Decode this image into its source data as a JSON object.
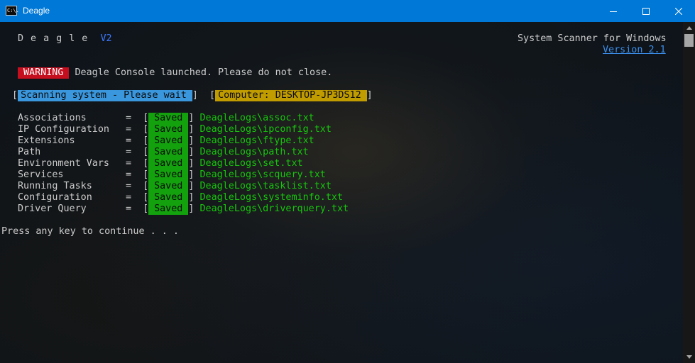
{
  "window": {
    "title": "Deagle",
    "icon": "console-icon",
    "icon_text": "C:\\.",
    "controls": [
      "minimize-icon",
      "maximize-icon",
      "close-icon"
    ]
  },
  "header": {
    "brand": "Deagle",
    "brand_version": "V2",
    "subtitle": "System Scanner for Windows",
    "version_link": "Version 2.1"
  },
  "warning": {
    "badge": "WARNING",
    "message": "Deagle Console launched. Please do not close."
  },
  "status": {
    "scanning": "Scanning system - Please wait",
    "computer": "Computer: DESKTOP-JP3DS12"
  },
  "results": [
    {
      "label": "Associations",
      "status": "Saved",
      "path": "DeagleLogs\\assoc.txt"
    },
    {
      "label": "IP Configuration",
      "status": "Saved",
      "path": "DeagleLogs\\ipconfig.txt"
    },
    {
      "label": "Extensions",
      "status": "Saved",
      "path": "DeagleLogs\\ftype.txt"
    },
    {
      "label": "Path",
      "status": "Saved",
      "path": "DeagleLogs\\path.txt"
    },
    {
      "label": "Environment Vars",
      "status": "Saved",
      "path": "DeagleLogs\\set.txt"
    },
    {
      "label": "Services",
      "status": "Saved",
      "path": "DeagleLogs\\scquery.txt"
    },
    {
      "label": "Running Tasks",
      "status": "Saved",
      "path": "DeagleLogs\\tasklist.txt"
    },
    {
      "label": "Configuration",
      "status": "Saved",
      "path": "DeagleLogs\\systeminfo.txt"
    },
    {
      "label": "Driver Query",
      "status": "Saved",
      "path": "DeagleLogs\\driverquery.txt"
    }
  ],
  "prompt": "Press any key to continue . . .",
  "colors": {
    "titlebar": "#0078d7",
    "warning": "#c50f1f",
    "scanning": "#3a96dd",
    "computer": "#c19c00",
    "saved": "#13a10e",
    "path_text": "#16c60c",
    "link": "#3b8eea"
  }
}
